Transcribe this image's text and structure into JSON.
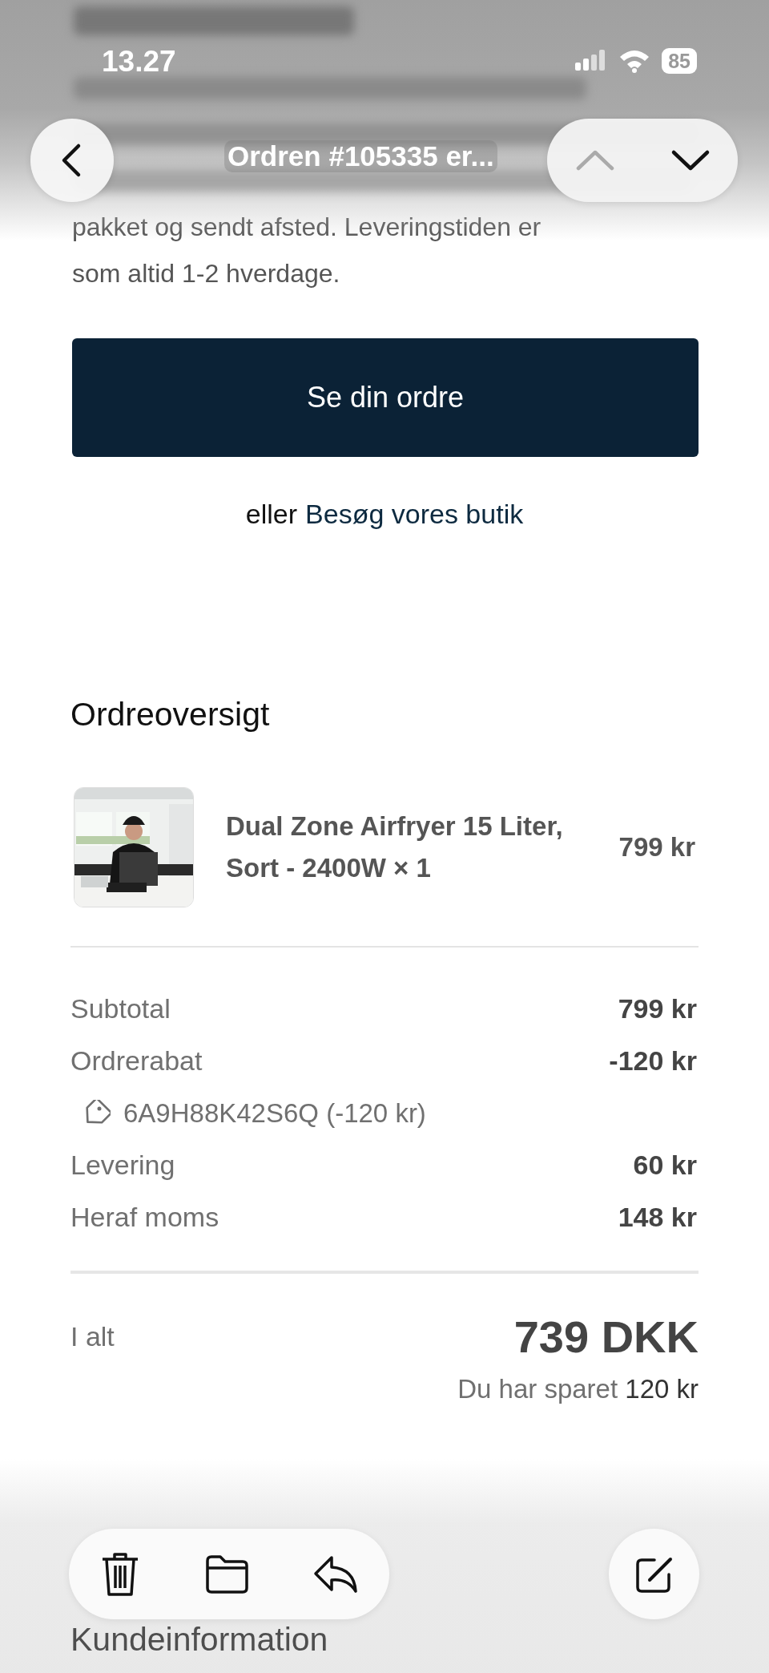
{
  "status_bar": {
    "time": "13.27",
    "battery": "85"
  },
  "nav": {
    "title": "Ordren #105335 er...",
    "previous_disabled": true,
    "next_disabled": false
  },
  "email": {
    "message": "pakket og sendt afsted. Leveringstiden er som altid 1-2 hverdage.",
    "button": "Se din ordre",
    "alt_prefix": "eller",
    "alt_link": "Besøg vores butik"
  },
  "summary": {
    "heading": "Ordreoversigt",
    "items": [
      {
        "name": "Dual Zone Airfryer 15 Liter, Sort - 2400W × 1",
        "price": "799 kr"
      }
    ],
    "lines": [
      {
        "kind": "line",
        "label": "Subtotal",
        "value": "799 kr"
      },
      {
        "kind": "line",
        "label": "Ordrerabat",
        "value": "-120 kr"
      },
      {
        "kind": "code",
        "label": "6A9H88K42S6Q (-120 kr)"
      },
      {
        "kind": "line",
        "label": "Levering",
        "value": "60 kr"
      },
      {
        "kind": "line",
        "label": "Heraf moms",
        "value": "148 kr"
      }
    ],
    "total_label": "I alt",
    "total": "739 DKK",
    "savings_prefix": "Du har sparet",
    "savings": "120 kr"
  },
  "next_heading": "Kundeinformation"
}
